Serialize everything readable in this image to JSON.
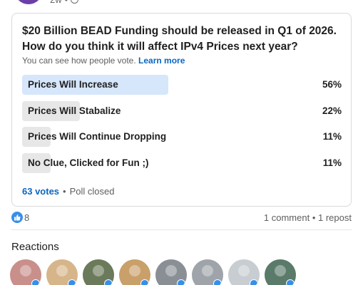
{
  "post": {
    "time_ago": "2w",
    "separator": "•"
  },
  "poll": {
    "question": "$20 Billion BEAD Funding should be released in Q1 of 2026. How do you think it will affect IPv4 Prices next year?",
    "note": "You can see how people vote.",
    "learn_more": "Learn more",
    "options": [
      {
        "label": "Prices Will Increase",
        "percent_text": "56%",
        "percent": 56,
        "selected": true
      },
      {
        "label": "Prices Will Stabalize",
        "percent_text": "22%",
        "percent": 22,
        "selected": false
      },
      {
        "label": "Prices Will Continue Dropping",
        "percent_text": "11%",
        "percent": 11,
        "selected": false
      },
      {
        "label": "No Clue, Clicked for Fun ;)",
        "percent_text": "11%",
        "percent": 11,
        "selected": false
      }
    ],
    "votes": "63 votes",
    "dot": "•",
    "status": "Poll closed"
  },
  "social": {
    "like_count": "8",
    "comments": "1 comment",
    "dot": "•",
    "reposts": "1 repost",
    "reaction_icon": "like-icon",
    "like_color": "#378fe9"
  },
  "reactions": {
    "heading": "Reactions",
    "avatars": [
      {
        "name": "reactor-avatar-1",
        "color": "#c98f8a"
      },
      {
        "name": "reactor-avatar-2",
        "color": "#d7b58a"
      },
      {
        "name": "reactor-avatar-3",
        "color": "#6b7a5a"
      },
      {
        "name": "reactor-avatar-4",
        "color": "#c9a06a"
      },
      {
        "name": "reactor-avatar-5",
        "color": "#8a8f96"
      },
      {
        "name": "reactor-avatar-6",
        "color": "#9ea4aa"
      },
      {
        "name": "reactor-avatar-7",
        "color": "#c8cdd2"
      },
      {
        "name": "reactor-avatar-8",
        "color": "#5a7a6a"
      }
    ]
  },
  "colors": {
    "accent": "#0a66c2",
    "selected_fill": "#d6e6fb",
    "bar_fill": "#e7e7e7"
  }
}
